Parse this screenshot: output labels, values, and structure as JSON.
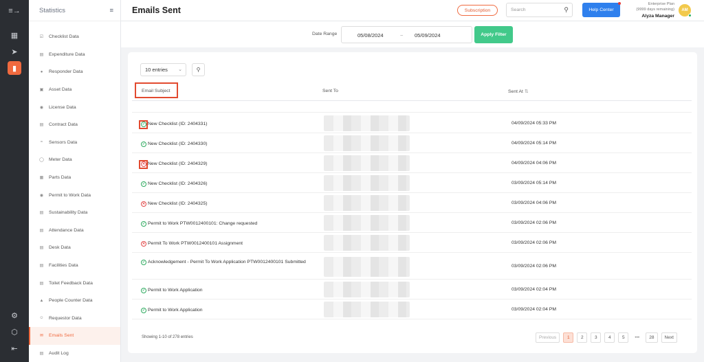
{
  "sidebar": {
    "title": "Statistics",
    "items": [
      {
        "label": "Checklist Data",
        "icon": "checklist-icon",
        "active": false
      },
      {
        "label": "Expenditure Data",
        "icon": "expenditure-icon",
        "active": false
      },
      {
        "label": "Responder Data",
        "icon": "responder-icon",
        "active": false
      },
      {
        "label": "Asset Data",
        "icon": "asset-icon",
        "active": false
      },
      {
        "label": "License Data",
        "icon": "license-icon",
        "active": false
      },
      {
        "label": "Contract Data",
        "icon": "contract-icon",
        "active": false
      },
      {
        "label": "Sensors Data",
        "icon": "sensors-icon",
        "active": false
      },
      {
        "label": "Meter Data",
        "icon": "meter-icon",
        "active": false
      },
      {
        "label": "Parts Data",
        "icon": "parts-icon",
        "active": false
      },
      {
        "label": "Permit to Work Data",
        "icon": "permit-icon",
        "active": false
      },
      {
        "label": "Sustainability Data",
        "icon": "sustainability-icon",
        "active": false
      },
      {
        "label": "Attendance Data",
        "icon": "attendance-icon",
        "active": false
      },
      {
        "label": "Desk Data",
        "icon": "desk-icon",
        "active": false
      },
      {
        "label": "Facilities Data",
        "icon": "facilities-icon",
        "active": false
      },
      {
        "label": "Toilet Feedback Data",
        "icon": "feedback-icon",
        "active": false
      },
      {
        "label": "People Counter Data",
        "icon": "people-counter-icon",
        "active": false
      },
      {
        "label": "Requestor Data",
        "icon": "requestor-icon",
        "active": false
      },
      {
        "label": "Emails Sent",
        "icon": "mail-icon",
        "active": true
      },
      {
        "label": "Audit Log",
        "icon": "audit-icon",
        "active": false
      }
    ]
  },
  "header": {
    "title": "Emails Sent",
    "subscription_label": "Subscription",
    "search_placeholder": "Search",
    "help_label": "Help Center",
    "plan_line1": "Enterprise Plan",
    "plan_line2": "(9999 days remaining)",
    "user_name": "Alyza Manager",
    "avatar_initials": "AM"
  },
  "filter": {
    "label": "Date Range",
    "from": "05/08/2024",
    "separator": "~",
    "to": "05/09/2024",
    "apply_label": "Apply Filter"
  },
  "table": {
    "page_size": "10 entries",
    "columns": {
      "subject": "Email Subject",
      "sent_to": "Sent To",
      "sent_at": "Sent At",
      "sort_icon": "⇅"
    },
    "rows": [
      {
        "status": "success",
        "subject": "New Checklist (ID: 2404331)",
        "sent_at": "04/09/2024 05:33 PM"
      },
      {
        "status": "success",
        "subject": "New Checklist (ID: 2404330)",
        "sent_at": "04/09/2024 05:14 PM"
      },
      {
        "status": "failed",
        "subject": "New Checklist (ID: 2404329)",
        "sent_at": "04/09/2024 04:06 PM"
      },
      {
        "status": "success",
        "subject": "New Checklist (ID: 2404326)",
        "sent_at": "03/09/2024 05:14 PM"
      },
      {
        "status": "failed",
        "subject": "New Checklist (ID: 2404325)",
        "sent_at": "03/09/2024 04:06 PM"
      },
      {
        "status": "success",
        "subject": "Permit to Work PTW0012400101: Change requested",
        "sent_at": "03/09/2024 02:06 PM"
      },
      {
        "status": "failed",
        "subject": "Permit To Work PTW0012400101 Assignment",
        "sent_at": "03/09/2024 02:06 PM"
      },
      {
        "status": "success",
        "subject": "Acknowledgement - Permit To Work Application PTW0012400101 Submitted",
        "sent_at": "03/09/2024 02:06 PM"
      },
      {
        "status": "success",
        "subject": "Permit to Work Application",
        "sent_at": "03/09/2024 02:04 PM"
      },
      {
        "status": "success",
        "subject": "Permit to Work Application",
        "sent_at": "03/09/2024 02:04 PM"
      }
    ],
    "showing_text": "Showing 1-10 of 278 entries"
  },
  "pagination": {
    "previous": "Previous",
    "pages": [
      "1",
      "2",
      "3",
      "4",
      "5"
    ],
    "current": "1",
    "ellipsis": "•••",
    "last": "28",
    "next": "Next"
  },
  "colors": {
    "accent": "#f06a3f",
    "primary": "#2f80ed",
    "success": "#2eaa5f",
    "error": "#e24a4a",
    "apply": "#42c98a"
  }
}
